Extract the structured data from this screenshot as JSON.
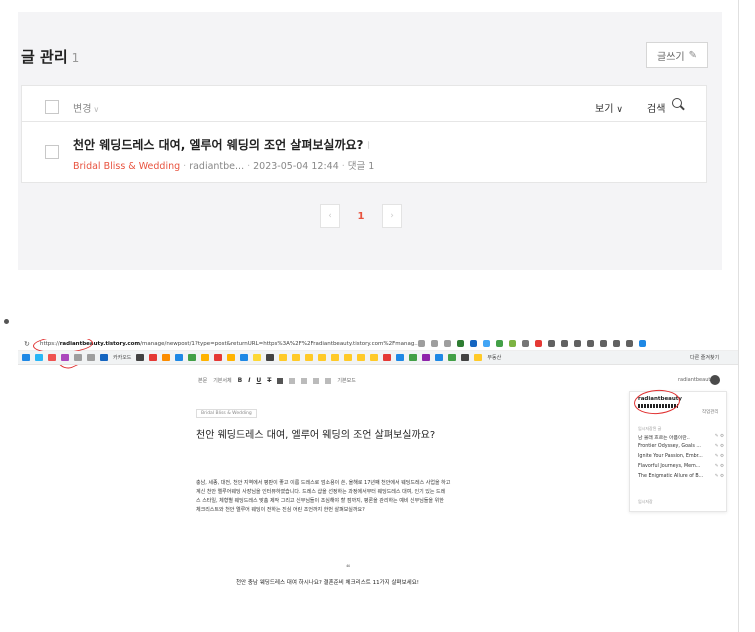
{
  "panel": {
    "title": "글 관리",
    "count": "1",
    "write_button": "글쓰기",
    "write_icon": "pencil-icon"
  },
  "toolbar": {
    "change_label": "변경",
    "view_label": "보기",
    "search_label": "검색"
  },
  "post": {
    "title": "천안 웨딩드레스 대여, 엘루어 웨딩의 조언 살펴보실까요?",
    "category": "Bridal Bliss & Wedding",
    "author": "radiantbe...",
    "datetime": "2023-05-04 12:44",
    "comments": "댓글 1"
  },
  "pagination": {
    "current": "1",
    "prev": "‹",
    "next": "›"
  },
  "screenshot": {
    "url_domain": "radiantbeauty.tistory.com",
    "url_rest": "/manage/newpost/1?type=post&returnURL=https%3A%2F%2Fradiantbeauty.tistory.com%2Fmanag...",
    "url_prefix": "https://",
    "bookmark_folder": "카카오드",
    "bookmark_right": "다른 즐겨찾기",
    "bookmark_middle": "부동산",
    "editor": {
      "basic": "본문",
      "basic_font": "기본서체",
      "bold": "B",
      "italic": "I",
      "underline": "U",
      "strike": "T",
      "more": "기본모드",
      "user": "radiantbeauty"
    },
    "category_tag": "Bridal Bliss & Wedding",
    "doc_title": "천안 웨딩드레스 대여, 엘루어 웨딩의 조언 살펴보실까요?",
    "doc_body": [
      "충남, 세종, 대전, 천안 지역에서 평판이 좋고 이름 드레스로 엄소용이 쓴, 올해로 17년째 천안에서 웨딩드레스 사업을 하고",
      "계신 천안 엘루어웨딩 사장님을 인터뷰하였습니다. 드레스 샵을 선정하는 과정에서부터 웨딩드레스 대여, 인기 있는 드레",
      "스 스타일, 체형별 웨딩드레스 맞춤 제작 그리고 신부님들이 조심해야 할 점까지, 평론을 관리하는 예비 신부님들을 위한",
      "체크리스트와 천안 엘루어 웨딩이 전하는 진심 어린 조언까지 한번 살펴보실까요?"
    ],
    "quote_mark": "❝",
    "quote_text": "천안 충남 웨딩드레스 대여 하시나요? 결혼준비 체크리스트 11가지 살펴보세요!",
    "side_panel": {
      "name": "radiantbeauty",
      "manage": "작업관리",
      "section": "임시저장된 글",
      "items": [
        "남 몰래 흐르는 아픔이란..",
        "Frontier Odyssey, Goals ...",
        "Ignite Your Passion, Embr...",
        "Flavorful Journeys, Mem...",
        "The Enigmatic Allure of B..."
      ],
      "footer": "임시저장"
    }
  }
}
